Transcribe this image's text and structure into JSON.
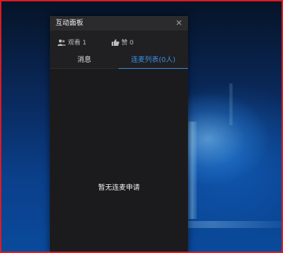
{
  "panel": {
    "title": "互动面板",
    "close_icon": "close-icon"
  },
  "stats": {
    "watch": {
      "icon": "users-icon",
      "label": "观看 1"
    },
    "like": {
      "icon": "thumbs-up-icon",
      "label": "赞 0"
    }
  },
  "tabs": [
    {
      "label": "消息",
      "active": false
    },
    {
      "label": "连麦列表(0人)",
      "active": true
    }
  ],
  "content": {
    "empty_text": "暂无连麦申请"
  },
  "colors": {
    "accent": "#3a8ee6",
    "panel_bg": "#1b1b1d",
    "frame": "#e01a22"
  }
}
